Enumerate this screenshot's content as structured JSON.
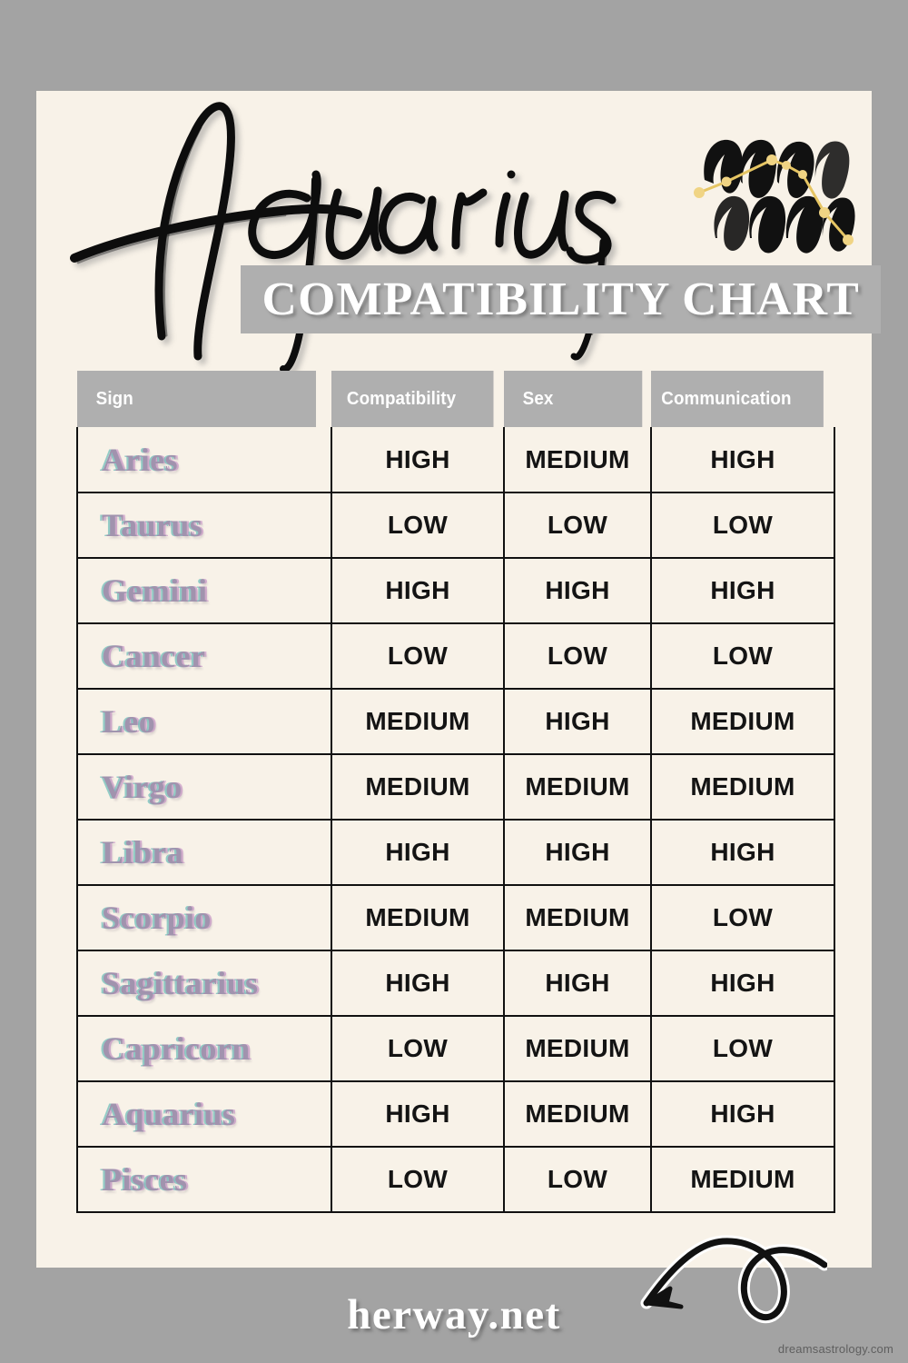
{
  "poster": {
    "title": "Aquarius",
    "subtitle": "COMPATIBILITY CHART",
    "glyph_icon": "aquarius-constellation-icon",
    "background_color": "#f8f2e8",
    "page_color": "#a3a3a3",
    "banner_color": "#afafaf"
  },
  "table": {
    "columns": [
      "Sign",
      "Compatibility",
      "Sex",
      "Communication"
    ],
    "rows": [
      {
        "sign": "Aries",
        "compatibility": "HIGH",
        "sex": "MEDIUM",
        "communication": "HIGH"
      },
      {
        "sign": "Taurus",
        "compatibility": "LOW",
        "sex": "LOW",
        "communication": "LOW"
      },
      {
        "sign": "Gemini",
        "compatibility": "HIGH",
        "sex": "HIGH",
        "communication": "HIGH"
      },
      {
        "sign": "Cancer",
        "compatibility": "LOW",
        "sex": "LOW",
        "communication": "LOW"
      },
      {
        "sign": "Leo",
        "compatibility": "MEDIUM",
        "sex": "HIGH",
        "communication": "MEDIUM"
      },
      {
        "sign": "Virgo",
        "compatibility": "MEDIUM",
        "sex": "MEDIUM",
        "communication": "MEDIUM"
      },
      {
        "sign": "Libra",
        "compatibility": "HIGH",
        "sex": "HIGH",
        "communication": "HIGH"
      },
      {
        "sign": "Scorpio",
        "compatibility": "MEDIUM",
        "sex": "MEDIUM",
        "communication": "LOW"
      },
      {
        "sign": "Sagittarius",
        "compatibility": "HIGH",
        "sex": "HIGH",
        "communication": "HIGH"
      },
      {
        "sign": "Capricorn",
        "compatibility": "LOW",
        "sex": "MEDIUM",
        "communication": "LOW"
      },
      {
        "sign": "Aquarius",
        "compatibility": "HIGH",
        "sex": "MEDIUM",
        "communication": "HIGH"
      },
      {
        "sign": "Pisces",
        "compatibility": "LOW",
        "sex": "LOW",
        "communication": "MEDIUM"
      }
    ]
  },
  "footer": {
    "site": "herway.net",
    "watermark": "dreamsastrology.com",
    "arrow_icon": "curled-arrow-icon"
  }
}
